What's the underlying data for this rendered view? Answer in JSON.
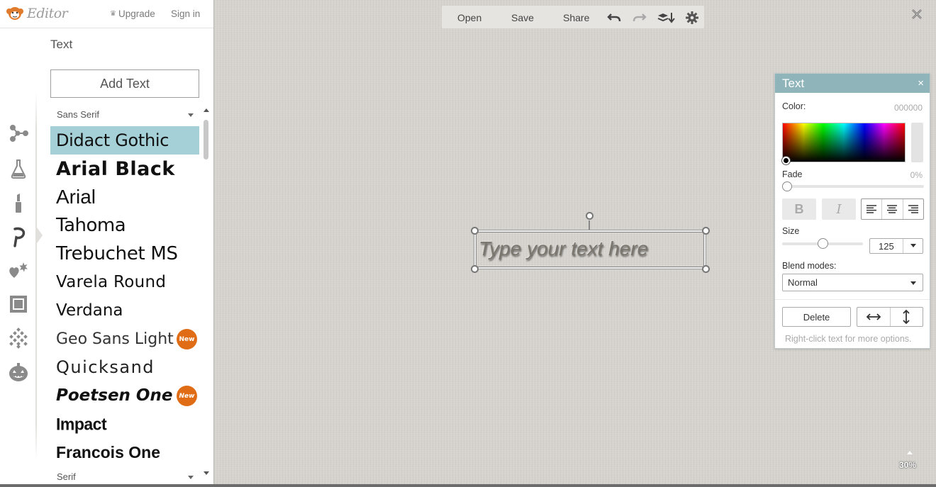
{
  "app": {
    "logo_text": "Editor",
    "upgrade": "Upgrade",
    "signin": "Sign in"
  },
  "panel": {
    "title": "Text",
    "add_text": "Add Text",
    "category": "Sans Serif",
    "next_category": "Serif",
    "fonts": [
      {
        "name": "Didact Gothic",
        "selected": true,
        "new": false
      },
      {
        "name": "Arial Black",
        "selected": false,
        "new": false
      },
      {
        "name": "Arial",
        "selected": false,
        "new": false
      },
      {
        "name": "Tahoma",
        "selected": false,
        "new": false
      },
      {
        "name": "Trebuchet MS",
        "selected": false,
        "new": false
      },
      {
        "name": "Varela Round",
        "selected": false,
        "new": false
      },
      {
        "name": "Verdana",
        "selected": false,
        "new": false
      },
      {
        "name": "Geo Sans Light",
        "selected": false,
        "new": true
      },
      {
        "name": "Quicksand",
        "selected": false,
        "new": false
      },
      {
        "name": "Poetsen One",
        "selected": false,
        "new": true
      },
      {
        "name": "Impact",
        "selected": false,
        "new": false
      },
      {
        "name": "Francois One",
        "selected": false,
        "new": false
      }
    ],
    "new_badge": "New"
  },
  "rail": {
    "icons": [
      "effects-icon",
      "flask-icon",
      "lipstick-icon",
      "text-tool-icon",
      "sticker-icon",
      "frame-icon",
      "texture-icon",
      "pumpkin-icon"
    ]
  },
  "toolbar": {
    "open": "Open",
    "save": "Save",
    "share": "Share"
  },
  "canvas": {
    "text_placeholder": "Type your text here",
    "zoom": "30%"
  },
  "text_panel": {
    "title": "Text",
    "close": "×",
    "color_label": "Color:",
    "color_value": "000000",
    "fade_label": "Fade",
    "fade_value": "0%",
    "fade": 0,
    "bold": "B",
    "italic": "I",
    "size_label": "Size",
    "size_value": "125",
    "blend_label": "Blend modes:",
    "blend_value": "Normal",
    "delete": "Delete",
    "hint": "Right-click text for more options."
  },
  "colors": {
    "selected_font_bg": "#a6d0d8",
    "panel_header": "#8fb5ba",
    "new_badge": "#e06d16"
  }
}
